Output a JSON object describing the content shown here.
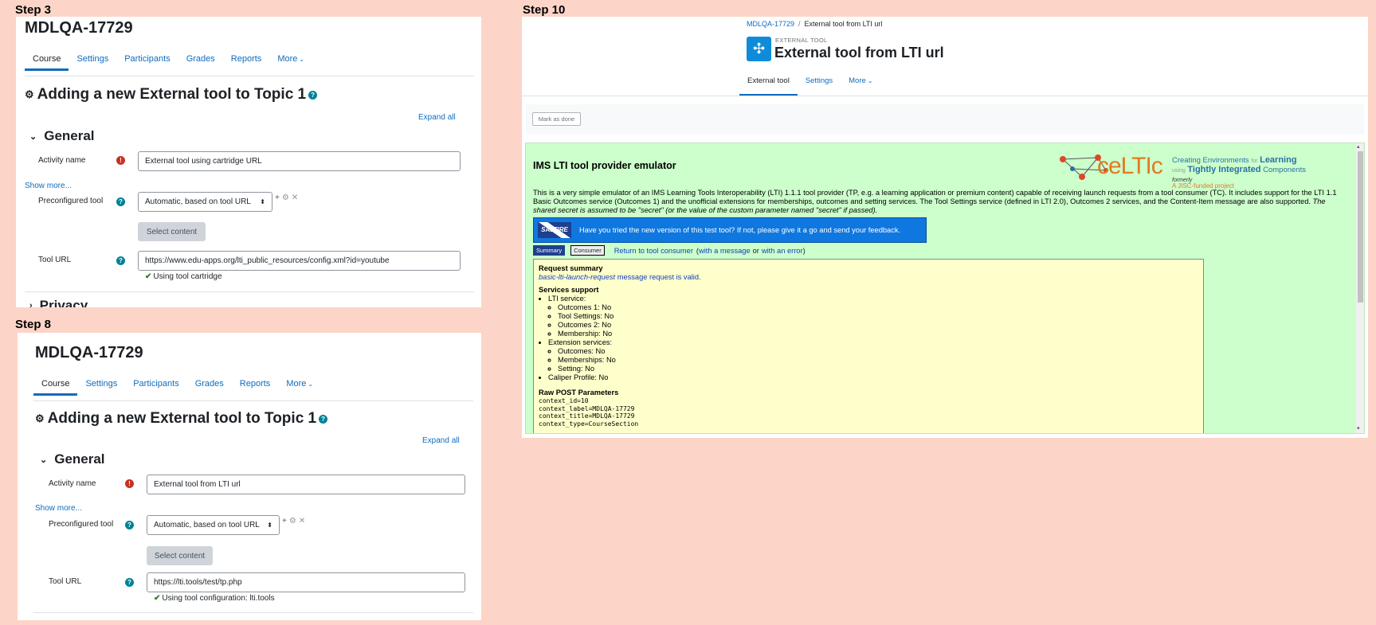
{
  "step3": {
    "label": "Step 3",
    "course_title": "MDLQA-17729",
    "tabs": [
      "Course",
      "Settings",
      "Participants",
      "Grades",
      "Reports",
      "More"
    ],
    "heading": "Adding a new External tool to Topic 1",
    "expand_all": "Expand all",
    "section_general": "General",
    "activity_name_label": "Activity name",
    "activity_name_value": "External tool using cartridge URL",
    "show_more": "Show more...",
    "preconfigured_label": "Preconfigured tool",
    "preconfigured_value": "Automatic, based on tool URL",
    "select_content": "Select content",
    "tool_url_label": "Tool URL",
    "tool_url_value": "https://www.edu-apps.org/lti_public_resources/config.xml?id=youtube",
    "tool_hint": "Using tool cartridge",
    "section_privacy": "Privacy"
  },
  "step8": {
    "label": "Step 8",
    "course_title": "MDLQA-17729",
    "tabs": [
      "Course",
      "Settings",
      "Participants",
      "Grades",
      "Reports",
      "More"
    ],
    "heading": "Adding a new External tool to Topic 1",
    "expand_all": "Expand all",
    "section_general": "General",
    "activity_name_label": "Activity name",
    "activity_name_value": "External tool from LTI url",
    "show_more": "Show more...",
    "preconfigured_label": "Preconfigured tool",
    "preconfigured_value": "Automatic, based on tool URL",
    "select_content": "Select content",
    "tool_url_label": "Tool URL",
    "tool_url_value": "https://lti.tools/test/tp.php",
    "tool_hint": "Using tool configuration: lti.tools"
  },
  "step10": {
    "label": "Step 10",
    "breadcrumb": [
      "MDLQA-17729",
      "External tool from LTI url"
    ],
    "kicker": "EXTERNAL TOOL",
    "title": "External tool from LTI url",
    "tabs": [
      "External tool",
      "Settings",
      "More"
    ],
    "mark_as_done": "Mark as done",
    "emulator": {
      "title": "IMS LTI tool provider emulator",
      "logo_text": "ceLTIc",
      "logo_line1": "Creating Environments",
      "logo_for": "for",
      "logo_learning": "Learning",
      "logo_using": "using",
      "logo_tight": "Tightly Integrated",
      "logo_components": "Components",
      "logo_formerly": "formerly",
      "logo_jisc": "A JISC-funded project",
      "desc": "This is a very simple emulator of an IMS Learning Tools Interoperability (LTI) 1.1.1 tool provider (TP, e.g. a learning application or premium content) capable of receiving launch requests from a tool consumer (TC). It includes support for the LTI 1.1 Basic Outcomes service (Outcomes 1) and the unofficial extensions for memberships, outcomes and setting services. The Tool Settings service (defined in LTI 2.0), Outcomes 2 services, and the Content-Item message are also supported.",
      "desc_em": "The shared secret is assumed to be \"secret\" (or the value of the custom parameter named \"secret\" if passed).",
      "saltire_logo": "SALTIRE",
      "saltire_text": "Have you tried the new version of this test tool? If not, please give it a go and send your feedback.",
      "btn_summary": "Summary",
      "btn_consumer": "Consumer",
      "return_link": "Return to tool consumer",
      "with_message": "with a message",
      "or": "or",
      "with_error": "with an error",
      "req_summary": "Request summary",
      "req_valid_link": "basic-lti-launch-request",
      "req_valid_rest": "message request is valid.",
      "services_support": "Services support",
      "lti_service": "LTI service:",
      "lti_items": [
        "Outcomes 1: No",
        "Tool Settings: No",
        "Outcomes 2: No",
        "Membership: No"
      ],
      "ext_service": "Extension services:",
      "ext_items": [
        "Outcomes: No",
        "Memberships: No",
        "Setting: No"
      ],
      "caliper": "Caliper Profile: No",
      "raw_post": "Raw POST Parameters",
      "raw_lines": [
        "context_id=10",
        "context_label=MDLQA-17729",
        "context_title=MDLQA-17729",
        "context_type=CourseSection"
      ]
    }
  }
}
